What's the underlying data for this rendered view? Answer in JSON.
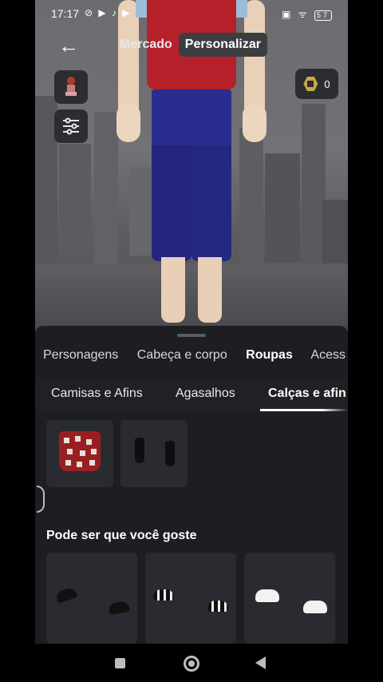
{
  "status_bar": {
    "time": "17:17",
    "left_icons": "⊘ ▶ ♪ ▶",
    "right_icons": "▣ ᯤ",
    "battery": "57"
  },
  "top_bar": {
    "back_icon": "arrow-left-icon",
    "tabs": [
      {
        "label": "Mercado",
        "active": false
      },
      {
        "label": "Personalizar",
        "active": true
      }
    ]
  },
  "robux": {
    "icon": "robux-icon",
    "balance": "0"
  },
  "side_buttons": [
    "avatar-thumbnail-icon",
    "sliders-icon"
  ],
  "categories": [
    {
      "label": "Personagens"
    },
    {
      "label": "Cabeça e corpo"
    },
    {
      "label": "Roupas",
      "selected": true
    },
    {
      "label": "Acess"
    }
  ],
  "subcategories": [
    {
      "label": "Camisas e Afins"
    },
    {
      "label": "Agasalhos"
    },
    {
      "label": "Calças e afin",
      "selected": true
    }
  ],
  "owned_items": [
    {
      "icon": "red-shorts-icon"
    },
    {
      "icon": "black-boots-icon"
    }
  ],
  "recommended": {
    "title": "Pode ser que você goste",
    "items": [
      {
        "icon": "black-slides-icon"
      },
      {
        "icon": "black-white-sneakers-icon"
      },
      {
        "icon": "white-sneakers-icon"
      }
    ]
  },
  "nav_bar": [
    "recents-square-icon",
    "home-circle-icon",
    "back-triangle-icon"
  ],
  "colors": {
    "panel_bg": "#1d1e22",
    "tile_bg": "#2a2b30",
    "shirt": "#b6202b",
    "pants": "#23257e"
  }
}
